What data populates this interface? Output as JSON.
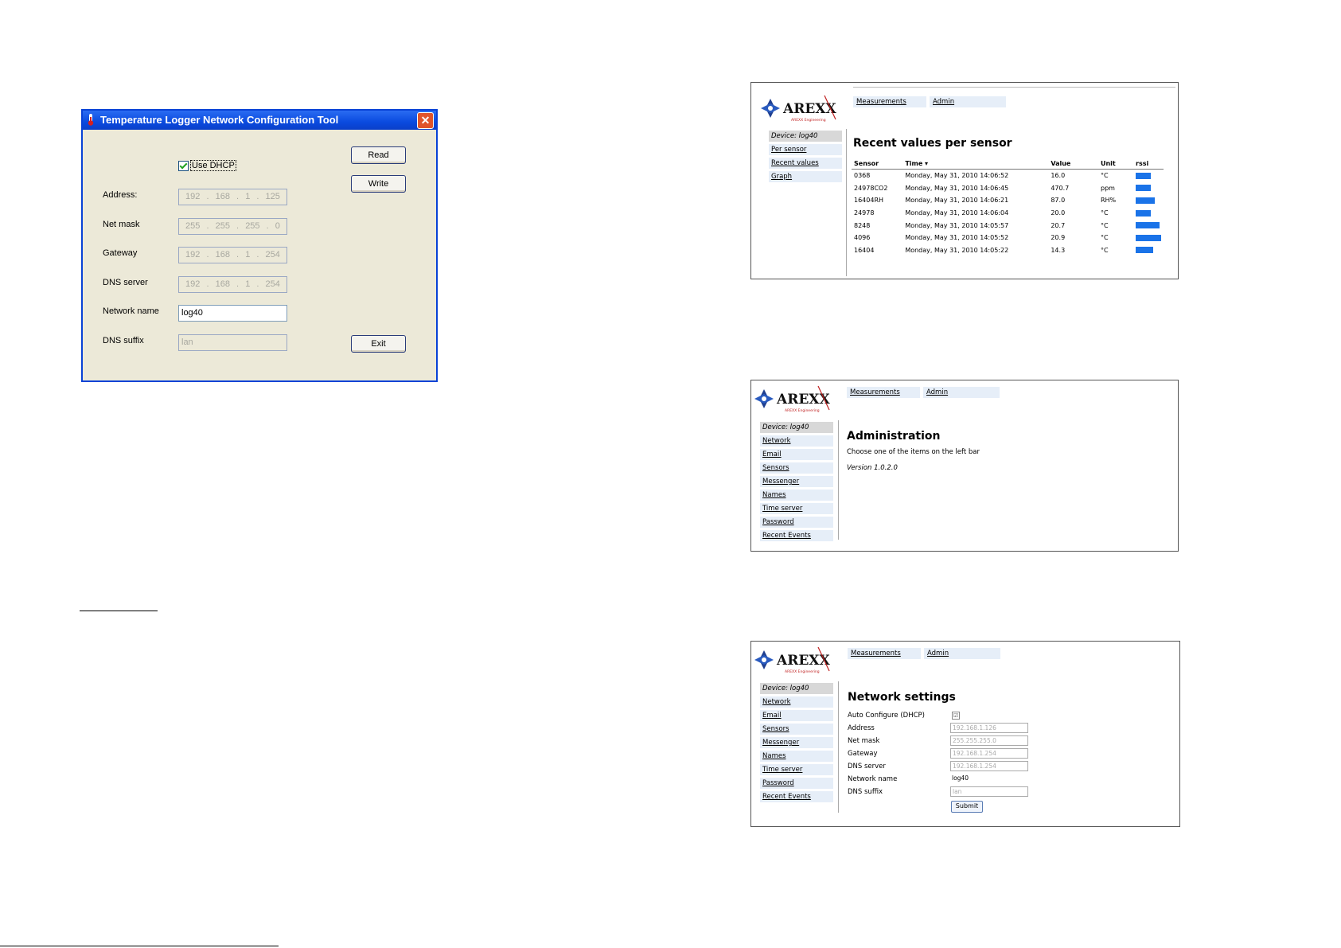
{
  "dialog": {
    "title": "Temperature Logger Network Configuration Tool",
    "close_glyph": "✕",
    "use_dhcp_label": "Use DHCP",
    "use_dhcp_checked": true,
    "read_label": "Read",
    "write_label": "Write",
    "exit_label": "Exit",
    "fields": {
      "address": {
        "label": "Address:",
        "octets": [
          "192",
          "168",
          "1",
          "125"
        ]
      },
      "netmask": {
        "label": "Net mask",
        "octets": [
          "255",
          "255",
          "255",
          "0"
        ]
      },
      "gateway": {
        "label": "Gateway",
        "octets": [
          "192",
          "168",
          "1",
          "254"
        ]
      },
      "dns": {
        "label": "DNS server",
        "octets": [
          "192",
          "168",
          "1",
          "254"
        ]
      },
      "network_name": {
        "label": "Network name",
        "value": "log40"
      },
      "dns_suffix": {
        "label": "DNS suffix",
        "value": "lan"
      }
    }
  },
  "web": {
    "brand": "AREXX",
    "brand_sub": "AREXX Engineering",
    "nav": {
      "measurements": "Measurements",
      "admin": "Admin"
    },
    "device_label": "Device: log40",
    "recent": {
      "sidebar": [
        "Per sensor",
        "Recent values",
        "Graph"
      ],
      "title": "Recent values per sensor",
      "columns": [
        "Sensor",
        "Time ▾",
        "Value",
        "Unit",
        "rssi"
      ],
      "rows": [
        {
          "sensor": "0368",
          "time": "Monday, May 31, 2010 14:06:52",
          "value": "16.0",
          "unit": "°C",
          "rssi": 0.6
        },
        {
          "sensor": "24978CO2",
          "time": "Monday, May 31, 2010 14:06:45",
          "value": "470.7",
          "unit": "ppm",
          "rssi": 0.6
        },
        {
          "sensor": "16404RH",
          "time": "Monday, May 31, 2010 14:06:21",
          "value": "87.0",
          "unit": "RH%",
          "rssi": 0.75
        },
        {
          "sensor": "24978",
          "time": "Monday, May 31, 2010 14:06:04",
          "value": "20.0",
          "unit": "°C",
          "rssi": 0.6
        },
        {
          "sensor": "8248",
          "time": "Monday, May 31, 2010 14:05:57",
          "value": "20.7",
          "unit": "°C",
          "rssi": 0.95
        },
        {
          "sensor": "4096",
          "time": "Monday, May 31, 2010 14:05:52",
          "value": "20.9",
          "unit": "°C",
          "rssi": 1.0
        },
        {
          "sensor": "16404",
          "time": "Monday, May 31, 2010 14:05:22",
          "value": "14.3",
          "unit": "°C",
          "rssi": 0.7
        }
      ]
    },
    "admin_sidebar": [
      "Network",
      "Email",
      "Sensors",
      "Messenger",
      "Names",
      "Time server",
      "Password",
      "Recent Events"
    ],
    "admin": {
      "title": "Administration",
      "text": "Choose one of the items on the left bar",
      "version": "Version 1.0.2.0"
    },
    "network": {
      "title": "Network settings",
      "auto_label": "Auto Configure (DHCP)",
      "auto_check": "☑",
      "address_label": "Address",
      "address_value": "192.168.1.126",
      "netmask_label": "Net mask",
      "netmask_value": "255.255.255.0",
      "gateway_label": "Gateway",
      "gateway_value": "192.168.1.254",
      "dns_label": "DNS server",
      "dns_value": "192.168.1.254",
      "name_label": "Network name",
      "name_value": "log40",
      "suffix_label": "DNS suffix",
      "suffix_value": "lan",
      "submit_label": "Submit"
    }
  }
}
